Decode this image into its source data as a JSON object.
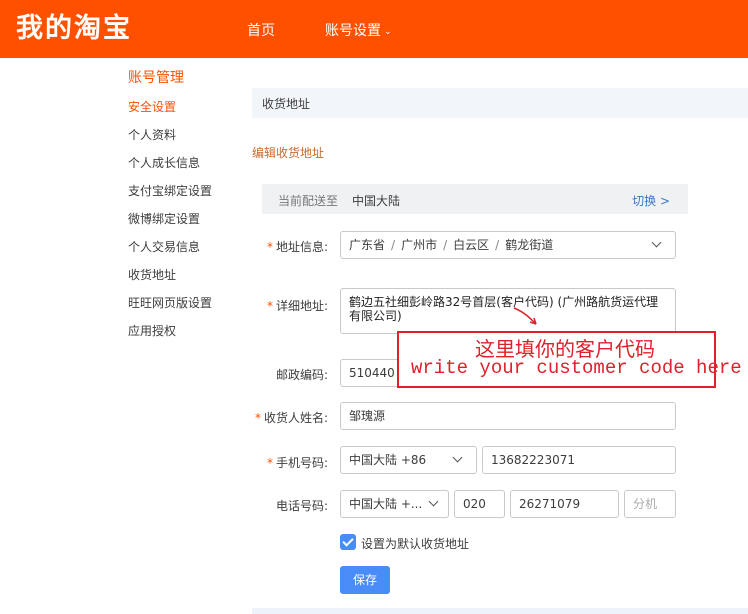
{
  "header": {
    "logo": "我的淘宝",
    "nav": [
      {
        "label": "首页"
      },
      {
        "label": "账号设置"
      }
    ],
    "caret": "⌄"
  },
  "sidebar": {
    "title": "账号管理",
    "items": [
      {
        "label": "安全设置",
        "active": true
      },
      {
        "label": "个人资料"
      },
      {
        "label": "个人成长信息"
      },
      {
        "label": "支付宝绑定设置"
      },
      {
        "label": "微博绑定设置"
      },
      {
        "label": "个人交易信息"
      },
      {
        "label": "收货地址"
      },
      {
        "label": "旺旺网页版设置"
      },
      {
        "label": "应用授权"
      }
    ]
  },
  "main": {
    "section_title": "收货地址",
    "edit_title": "编辑收货地址",
    "deliver": {
      "label": "当前配送至",
      "value": "中国大陆",
      "switch_label": "切换 >"
    },
    "form": {
      "required_mark": "*",
      "region": {
        "label": "地址信息:",
        "province": "广东省",
        "city": "广州市",
        "district": "白云区",
        "street": "鹤龙街道",
        "separator": "/"
      },
      "detail": {
        "label": "详细地址:",
        "value": "鹤边五社细彭岭路32号首层(客户代码)   (广州路航货运代理有限公司)"
      },
      "postal": {
        "label": "邮政编码:",
        "value": "510440"
      },
      "name": {
        "label": "收货人姓名:",
        "value": "邹瑰源"
      },
      "mobile": {
        "label": "手机号码:",
        "country": "中国大陆 +86",
        "value": "13682223071"
      },
      "phone": {
        "label": "电话号码:",
        "country": "中国大陆 +...",
        "area_code": "020",
        "number": "26271079",
        "extension_placeholder": "分机"
      },
      "default_checkbox": {
        "label": "设置为默认收货地址",
        "checked": true
      },
      "save_label": "保存"
    }
  },
  "annotation": {
    "cn": "这里填你的客户代码",
    "en": "write your customer code here",
    "color": "#e0202a"
  },
  "colors": {
    "brand": "#ff5000",
    "accent_blue": "#4a8cf7",
    "link_blue": "#3a77c2"
  }
}
